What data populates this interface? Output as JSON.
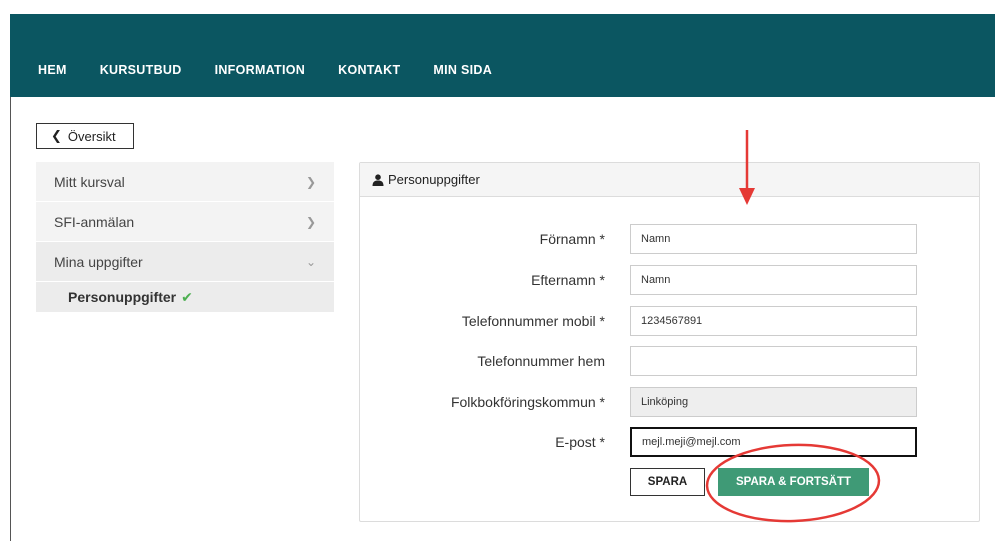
{
  "nav": {
    "items": [
      "HEM",
      "KURSUTBUD",
      "INFORMATION",
      "KONTAKT",
      "MIN SIDA"
    ]
  },
  "back_button": {
    "label": "Översikt",
    "icon": "chevron-left-icon"
  },
  "sidebar": {
    "items": [
      {
        "label": "Mitt kursval",
        "icon": "chevron-right-icon"
      },
      {
        "label": "SFI-anmälan",
        "icon": "chevron-right-icon"
      },
      {
        "label": "Mina uppgifter",
        "icon": "chevron-down-icon"
      }
    ],
    "sub_item": {
      "label": "Personuppgifter",
      "icon": "check-icon"
    }
  },
  "panel": {
    "title": "Personuppgifter",
    "icon": "user-icon",
    "fields": [
      {
        "label": "Förnamn *",
        "value": "Namn"
      },
      {
        "label": "Efternamn *",
        "value": "Namn"
      },
      {
        "label": "Telefonnummer mobil *",
        "value": "1234567891"
      },
      {
        "label": "Telefonnummer hem",
        "value": ""
      },
      {
        "label": "Folkbokföringskommun *",
        "value": "Linköping"
      },
      {
        "label": "E-post *",
        "value": "mejl.meji@mejl.com"
      }
    ],
    "save_label": "SPARA",
    "save_continue_label": "SPARA & FORTSÄTT"
  },
  "colors": {
    "navbar": "#0b5661",
    "primary_button": "#3f9a76",
    "annotation": "#e53935",
    "check": "#4caf50"
  }
}
